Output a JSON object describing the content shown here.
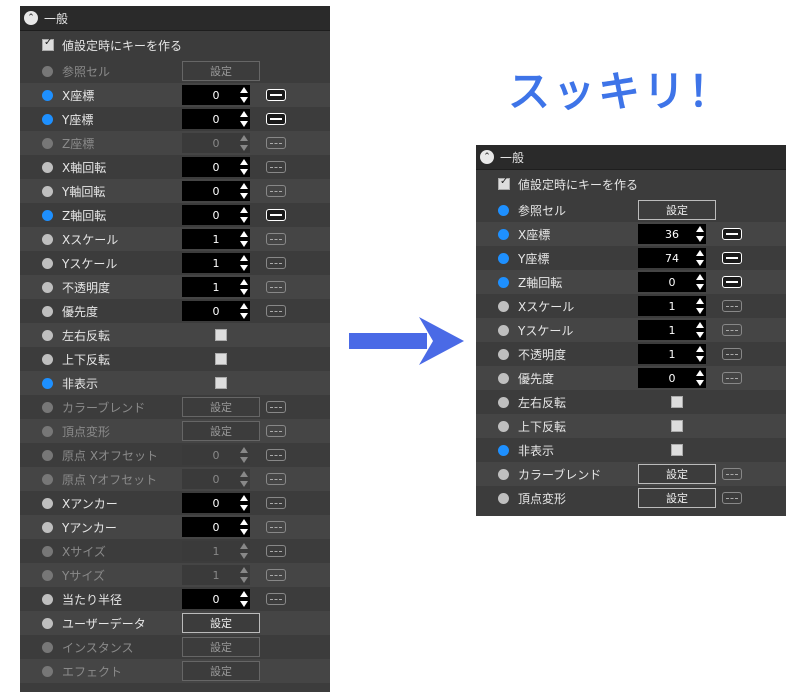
{
  "headline": "スッキリ！",
  "before": {
    "section_title": "一般",
    "key_on_set_label": "値設定時にキーを作る",
    "rows": [
      {
        "label": "参照セル",
        "dot": "gray",
        "control": "button",
        "value": "設定",
        "key": "none",
        "disabled": true
      },
      {
        "label": "X座標",
        "dot": "blue",
        "control": "number",
        "value": "0",
        "key": "on",
        "disabled": false
      },
      {
        "label": "Y座標",
        "dot": "blue",
        "control": "number",
        "value": "0",
        "key": "on",
        "disabled": false
      },
      {
        "label": "Z座標",
        "dot": "gray",
        "control": "number",
        "value": "0",
        "key": "off",
        "disabled": true
      },
      {
        "label": "X軸回転",
        "dot": "gray",
        "control": "number",
        "value": "0",
        "key": "off",
        "disabled": false
      },
      {
        "label": "Y軸回転",
        "dot": "gray",
        "control": "number",
        "value": "0",
        "key": "off",
        "disabled": false
      },
      {
        "label": "Z軸回転",
        "dot": "blue",
        "control": "number",
        "value": "0",
        "key": "on",
        "disabled": false
      },
      {
        "label": "Xスケール",
        "dot": "gray",
        "control": "number",
        "value": "1",
        "key": "off",
        "disabled": false
      },
      {
        "label": "Yスケール",
        "dot": "gray",
        "control": "number",
        "value": "1",
        "key": "off",
        "disabled": false
      },
      {
        "label": "不透明度",
        "dot": "gray",
        "control": "number",
        "value": "1",
        "key": "off",
        "disabled": false
      },
      {
        "label": "優先度",
        "dot": "gray",
        "control": "number",
        "value": "0",
        "key": "off",
        "disabled": false
      },
      {
        "label": "左右反転",
        "dot": "gray",
        "control": "checkbox",
        "value": "",
        "key": "none",
        "disabled": false
      },
      {
        "label": "上下反転",
        "dot": "gray",
        "control": "checkbox",
        "value": "",
        "key": "none",
        "disabled": false
      },
      {
        "label": "非表示",
        "dot": "blue",
        "control": "checkbox",
        "value": "",
        "key": "none",
        "disabled": false
      },
      {
        "label": "カラーブレンド",
        "dot": "gray",
        "control": "button",
        "value": "設定",
        "key": "off",
        "disabled": true
      },
      {
        "label": "頂点変形",
        "dot": "gray",
        "control": "button",
        "value": "設定",
        "key": "off",
        "disabled": true
      },
      {
        "label": "原点 Xオフセット",
        "dot": "gray",
        "control": "number",
        "value": "0",
        "key": "off",
        "disabled": true
      },
      {
        "label": "原点 Yオフセット",
        "dot": "gray",
        "control": "number",
        "value": "0",
        "key": "off",
        "disabled": true
      },
      {
        "label": "Xアンカー",
        "dot": "gray",
        "control": "number",
        "value": "0",
        "key": "off",
        "disabled": false
      },
      {
        "label": "Yアンカー",
        "dot": "gray",
        "control": "number",
        "value": "0",
        "key": "off",
        "disabled": false
      },
      {
        "label": "Xサイズ",
        "dot": "gray",
        "control": "number",
        "value": "1",
        "key": "off",
        "disabled": true
      },
      {
        "label": "Yサイズ",
        "dot": "gray",
        "control": "number",
        "value": "1",
        "key": "off",
        "disabled": true
      },
      {
        "label": "当たり半径",
        "dot": "gray",
        "control": "number",
        "value": "0",
        "key": "off",
        "disabled": false
      },
      {
        "label": "ユーザーデータ",
        "dot": "gray",
        "control": "button",
        "value": "設定",
        "key": "none",
        "disabled": false
      },
      {
        "label": "インスタンス",
        "dot": "gray",
        "control": "button",
        "value": "設定",
        "key": "none",
        "disabled": true
      },
      {
        "label": "エフェクト",
        "dot": "gray",
        "control": "button",
        "value": "設定",
        "key": "none",
        "disabled": true
      }
    ]
  },
  "after": {
    "section_title": "一般",
    "key_on_set_label": "値設定時にキーを作る",
    "rows": [
      {
        "label": "参照セル",
        "dot": "blue",
        "control": "button",
        "value": "設定",
        "key": "none",
        "disabled": false
      },
      {
        "label": "X座標",
        "dot": "blue",
        "control": "number",
        "value": "36",
        "key": "on",
        "disabled": false
      },
      {
        "label": "Y座標",
        "dot": "blue",
        "control": "number",
        "value": "74",
        "key": "on",
        "disabled": false
      },
      {
        "label": "Z軸回転",
        "dot": "blue",
        "control": "number",
        "value": "0",
        "key": "on",
        "disabled": false
      },
      {
        "label": "Xスケール",
        "dot": "gray",
        "control": "number",
        "value": "1",
        "key": "off",
        "disabled": false
      },
      {
        "label": "Yスケール",
        "dot": "gray",
        "control": "number",
        "value": "1",
        "key": "off",
        "disabled": false
      },
      {
        "label": "不透明度",
        "dot": "gray",
        "control": "number",
        "value": "1",
        "key": "off",
        "disabled": false
      },
      {
        "label": "優先度",
        "dot": "gray",
        "control": "number",
        "value": "0",
        "key": "off",
        "disabled": false
      },
      {
        "label": "左右反転",
        "dot": "gray",
        "control": "checkbox",
        "value": "",
        "key": "none",
        "disabled": false
      },
      {
        "label": "上下反転",
        "dot": "gray",
        "control": "checkbox",
        "value": "",
        "key": "none",
        "disabled": false
      },
      {
        "label": "非表示",
        "dot": "blue",
        "control": "checkbox",
        "value": "",
        "key": "none",
        "disabled": false
      },
      {
        "label": "カラーブレンド",
        "dot": "gray",
        "control": "button",
        "value": "設定",
        "key": "off",
        "disabled": false
      },
      {
        "label": "頂点変形",
        "dot": "gray",
        "control": "button",
        "value": "設定",
        "key": "off",
        "disabled": false
      }
    ]
  },
  "colors": {
    "accent": "#1e90ff",
    "headline": "#3e74e8",
    "arrow": "#4a6ae6",
    "panel": "#3c3c3c"
  }
}
